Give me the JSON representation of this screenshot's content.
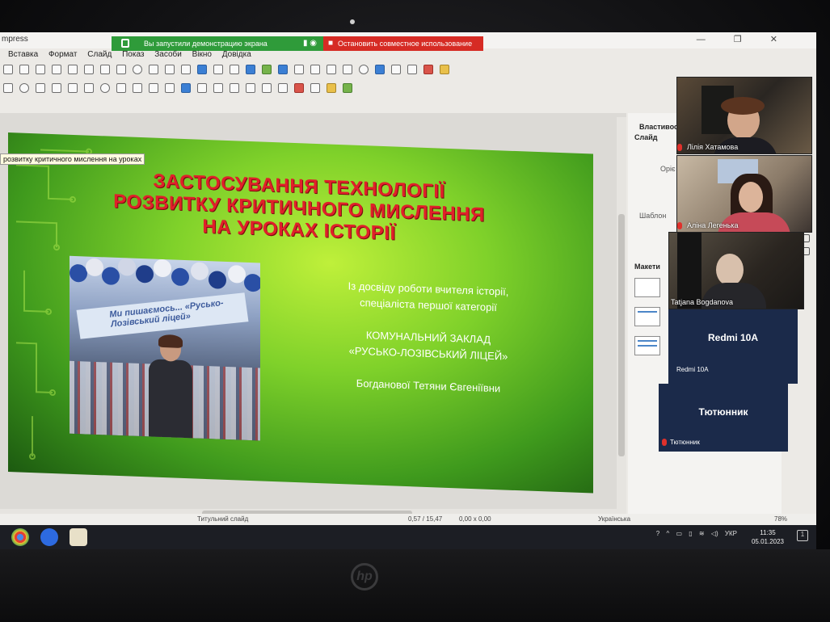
{
  "window": {
    "app_title": "mpress",
    "share_banner": "Вы запустили демонстрацию экрана",
    "stop_share": "Остановить совместное использование"
  },
  "menu": [
    "Вставка",
    "Формат",
    "Слайд",
    "Показ",
    "Засоби",
    "Вікно",
    "Довідка"
  ],
  "tooltip": "розвитку критичного мислення на уроках",
  "slide": {
    "title_line1": "ЗАСТОСУВАННЯ ТЕХНОЛОГІЇ",
    "title_line2": "РОЗВИТКУ КРИТИЧНОГО МИСЛЕННЯ",
    "title_line3": "НА УРОКАХ ІСТОРІЇ",
    "photo_banner": "Ми пишаємось... «Русько-Лозівський ліцей»",
    "info1": "Із досвіду роботи вчителя історії,",
    "info2": "спеціаліста першої категорії",
    "info3": "КОМУНАЛЬНИЙ ЗАКЛАД",
    "info4": "«РУСЬКО-ЛОЗІВСЬКИЙ ЛІЦЕЙ»",
    "info5": "Богданової Тетяни Євгеніївни"
  },
  "sidebar": {
    "properties": "Властивост",
    "slide_section": "Слайд",
    "orient": "Оріє",
    "template": "Шаблон",
    "layouts": "Макети"
  },
  "status": {
    "slide_name": "Титульний слайд",
    "position": "0,57 / 15,47",
    "size": "0,00 x 0,00",
    "language": "Українська",
    "zoom": "78%"
  },
  "taskbar": {
    "lang": "УКР",
    "time": "11:35",
    "date": "05.01.2023"
  },
  "participants": [
    {
      "name": "Лілія Хатамова"
    },
    {
      "name": "Аліна Легенька"
    },
    {
      "name": "Tatjana Bogdanova"
    }
  ],
  "device_tile": {
    "title": "Redmi 10A",
    "label": "Redmi 10A"
  },
  "last_tile": {
    "title": "Тютюнник",
    "label": "Тютюнник"
  },
  "brand": "hp"
}
